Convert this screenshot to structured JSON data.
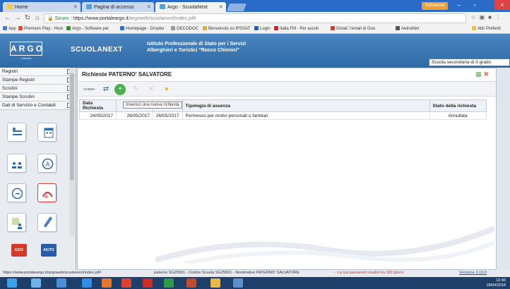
{
  "browser": {
    "tabs": [
      {
        "label": "Home"
      },
      {
        "label": "Pagina di accesso"
      },
      {
        "label": "Argo - ScuolaNext"
      }
    ],
    "user_badge": "Salvatore",
    "url_secure": "Sicuro",
    "url_host": "https://www.portaleargo.it",
    "url_path": "/argoweb/scuolanext/index.jsf#",
    "bookmarks": [
      {
        "label": "App",
        "color": "#4b7bd1"
      },
      {
        "label": "Premium Play - Hom",
        "color": "#e24b36"
      },
      {
        "label": "Argo - Software per",
        "color": "#3c8e3c"
      },
      {
        "label": "Homepage - Dropbo",
        "color": "#2f6fd8"
      },
      {
        "label": "GECODOC",
        "color": "#9a9a9a"
      },
      {
        "label": "Benvenuto su IPSSAT",
        "color": "#d8b040"
      },
      {
        "label": "Login",
        "color": "#2b5ab5"
      },
      {
        "label": "Italia.FM - Per ascolt",
        "color": "#c02828"
      },
      {
        "label": "Gmail: l'email di Goo",
        "color": "#d23f31"
      },
      {
        "label": "AetnaNet",
        "color": "#555555"
      },
      {
        "label": "Altri Preferiti",
        "color": "#e8c04a"
      }
    ]
  },
  "app": {
    "logo": "ARGO",
    "logo_sub": "software",
    "product": "SCUOLANEXT",
    "school_line1": "Istituto Professionale di Stato per i Servizi",
    "school_line2": "Alberghieri e Turistici \"Rocco Chinnici\"",
    "school_type": "Scuola secondaria di II grado"
  },
  "sidebar": {
    "items": [
      {
        "label": "Registri"
      },
      {
        "label": "Stampe Registri"
      },
      {
        "label": "Scrutini"
      },
      {
        "label": "Stampe Scrutini"
      },
      {
        "label": "Dati di Servizio e Contabili"
      }
    ],
    "buttons": {
      "esci": "ESCI",
      "aiuto": "AIUTO"
    }
  },
  "panel": {
    "title": "Richieste PATERNO' SALVATORE",
    "toolbar": {
      "close_label": "CHIUDI"
    },
    "tooltip": "Inserisci una nuova richiesta",
    "columns": [
      "Data Richiesta",
      "",
      "",
      "Tipologia di assenza",
      "Stato della richiesta"
    ],
    "rows": [
      {
        "data": "24/05/2017",
        "dal": "26/05/2017",
        "al": "26/05/2017",
        "tipologia": "Permesso per motivi personali o familiari",
        "stato": "Annullata"
      }
    ]
  },
  "status": {
    "url": "https://www.portaleargo.it/argoweb/scuolanext/index.jsf#",
    "info": "paterno SG25501 - Codice Scuola SG25501 - Nominativo PATERNO' SALVATORE",
    "warning": "- La tua password scadrà tra 180 giorni",
    "version": "Versione 3.19.0"
  },
  "taskbar": {
    "time": "13:46",
    "date": "18/04/2018"
  }
}
